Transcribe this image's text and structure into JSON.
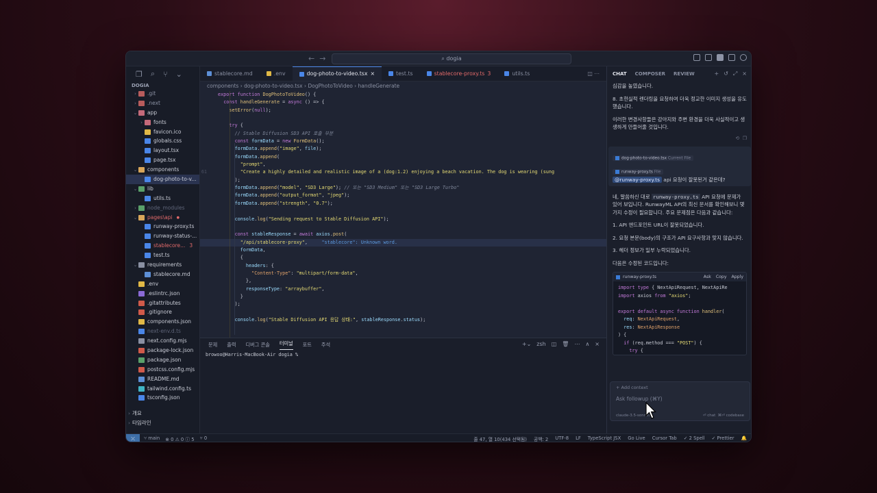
{
  "titlebar": {
    "search": "dogia"
  },
  "sidebar": {
    "title": "DOGIA",
    "items": [
      {
        "label": ".git",
        "indent": 1,
        "chev": "›",
        "color": "#8a90a2",
        "icon": "#b85c5c",
        "dim": true
      },
      {
        "label": ".next",
        "indent": 1,
        "chev": "›",
        "color": "#8a90a2",
        "icon": "#b85c5c",
        "dim": true
      },
      {
        "label": "app",
        "indent": 1,
        "chev": "⌄",
        "color": "#c9ccd6",
        "icon": "#c46a7a"
      },
      {
        "label": "fonts",
        "indent": 2,
        "chev": "›",
        "color": "#c9ccd6",
        "icon": "#c46a7a"
      },
      {
        "label": "favicon.ico",
        "indent": 2,
        "chev": "",
        "color": "#c9ccd6",
        "icon": "#e0b846"
      },
      {
        "label": "globals.css",
        "indent": 2,
        "chev": "",
        "color": "#c9ccd6",
        "icon": "#4a86e8"
      },
      {
        "label": "layout.tsx",
        "indent": 2,
        "chev": "",
        "color": "#c9ccd6",
        "icon": "#4a86e8"
      },
      {
        "label": "page.tsx",
        "indent": 2,
        "chev": "",
        "color": "#c9ccd6",
        "icon": "#4a86e8"
      },
      {
        "label": "components",
        "indent": 1,
        "chev": "⌄",
        "color": "#c9ccd6",
        "icon": "#d8a65a"
      },
      {
        "label": "dog-photo-to-v...",
        "indent": 2,
        "chev": "",
        "color": "#c9ccd6",
        "icon": "#4a86e8",
        "active": true
      },
      {
        "label": "lib",
        "indent": 1,
        "chev": "⌄",
        "color": "#c9ccd6",
        "icon": "#5aa06a"
      },
      {
        "label": "utils.ts",
        "indent": 2,
        "chev": "",
        "color": "#c9ccd6",
        "icon": "#4a86e8"
      },
      {
        "label": "node_modules",
        "indent": 1,
        "chev": "›",
        "color": "#5e6478",
        "icon": "#5aa06a",
        "dim": true
      },
      {
        "label": "pages\\api",
        "indent": 1,
        "chev": "⌄",
        "color": "#e26a6a",
        "icon": "#d8a65a",
        "dot": true
      },
      {
        "label": "runway-proxy.ts",
        "indent": 2,
        "chev": "",
        "color": "#c9ccd6",
        "icon": "#4a86e8"
      },
      {
        "label": "runway-status-...",
        "indent": 2,
        "chev": "",
        "color": "#c9ccd6",
        "icon": "#4a86e8"
      },
      {
        "label": "stablecore...",
        "indent": 2,
        "chev": "",
        "color": "#e26a6a",
        "icon": "#4a86e8",
        "badge": "3"
      },
      {
        "label": "test.ts",
        "indent": 2,
        "chev": "",
        "color": "#c9ccd6",
        "icon": "#4a86e8"
      },
      {
        "label": "requirements",
        "indent": 1,
        "chev": "⌄",
        "color": "#c9ccd6",
        "icon": "#8a90a2"
      },
      {
        "label": "stablecore.md",
        "indent": 2,
        "chev": "",
        "color": "#c9ccd6",
        "icon": "#5d8fd6"
      },
      {
        "label": ".env",
        "indent": 1,
        "chev": "",
        "color": "#c9ccd6",
        "icon": "#e0b846"
      },
      {
        "label": ".eslintrc.json",
        "indent": 1,
        "chev": "",
        "color": "#c9ccd6",
        "icon": "#8a6ad6"
      },
      {
        "label": ".gitattributes",
        "indent": 1,
        "chev": "",
        "color": "#c9ccd6",
        "icon": "#d05a4a"
      },
      {
        "label": ".gitignore",
        "indent": 1,
        "chev": "",
        "color": "#c9ccd6",
        "icon": "#d05a4a"
      },
      {
        "label": "components.json",
        "indent": 1,
        "chev": "",
        "color": "#c9ccd6",
        "icon": "#e0b846"
      },
      {
        "label": "next-env.d.ts",
        "indent": 1,
        "chev": "",
        "color": "#5e6478",
        "icon": "#4a86e8",
        "dim": true
      },
      {
        "label": "next.config.mjs",
        "indent": 1,
        "chev": "",
        "color": "#c9ccd6",
        "icon": "#8a90a2"
      },
      {
        "label": "package-lock.json",
        "indent": 1,
        "chev": "",
        "color": "#c9ccd6",
        "icon": "#d05a4a"
      },
      {
        "label": "package.json",
        "indent": 1,
        "chev": "",
        "color": "#c9ccd6",
        "icon": "#5aa06a"
      },
      {
        "label": "postcss.config.mjs",
        "indent": 1,
        "chev": "",
        "color": "#c9ccd6",
        "icon": "#d05a4a"
      },
      {
        "label": "README.md",
        "indent": 1,
        "chev": "",
        "color": "#c9ccd6",
        "icon": "#5d8fd6"
      },
      {
        "label": "tailwind.config.ts",
        "indent": 1,
        "chev": "",
        "color": "#c9ccd6",
        "icon": "#40b4c4"
      },
      {
        "label": "tsconfig.json",
        "indent": 1,
        "chev": "",
        "color": "#c9ccd6",
        "icon": "#4a86e8"
      }
    ],
    "bottom": [
      "개요",
      "타임라인"
    ]
  },
  "tabs": [
    {
      "label": "stablecore.md",
      "icon": "#5d8fd6"
    },
    {
      "label": ".env",
      "icon": "#e0b846"
    },
    {
      "label": "dog-photo-to-video.tsx",
      "icon": "#4a86e8",
      "active": true,
      "close": "×"
    },
    {
      "label": "test.ts",
      "icon": "#4a86e8"
    },
    {
      "label": "stablecore-proxy.ts",
      "icon": "#4a86e8",
      "error": true,
      "badge": "3"
    },
    {
      "label": "utils.ts",
      "icon": "#4a86e8"
    }
  ],
  "breadcrumb": "components  ›  dog-photo-to-video.tsx  ›  DogPhotoToVideo  ›  handleGenerate",
  "code_lines": [
    {
      "n": "",
      "t": "<span class='kw'>export function</span> <span class='fn'>DogPhotoToVideo</span>() {"
    },
    {
      "n": "",
      "t": "  <span class='kw'>const</span> <span class='fn'>handleGenerate</span> = <span class='kw'>async</span> () => {"
    },
    {
      "n": "",
      "t": "    <span class='fn'>setError</span>(<span class='kw'>null</span>);"
    },
    {
      "n": "",
      "t": ""
    },
    {
      "n": "",
      "t": "    <span class='kw'>try</span> {"
    },
    {
      "n": "",
      "t": "      <span class='cm'>// Stable Diffusion SD3 API 호출 부분</span>"
    },
    {
      "n": "",
      "t": "      <span class='kw'>const</span> <span class='vr'>formData</span> = <span class='kw'>new</span> <span class='fn'>FormData</span>();"
    },
    {
      "n": "",
      "t": "      <span class='vr'>formData</span>.<span class='fn'>append</span>(<span class='str'>\"image\"</span>, <span class='vr'>file</span>);"
    },
    {
      "n": "",
      "t": "      <span class='vr'>formData</span>.<span class='fn'>append</span>("
    },
    {
      "n": "",
      "t": "        <span class='str'>\"prompt\"</span>,"
    },
    {
      "n": "61",
      "t": "        <span class='str'>\"Create a highly detailed and realistic image of a (dog:1.2) enjoying a beach vacation. The dog is wearing (sung</span>"
    },
    {
      "n": "",
      "t": "      );"
    },
    {
      "n": "",
      "t": "      <span class='vr'>formData</span>.<span class='fn'>append</span>(<span class='str'>\"model\"</span>, <span class='str'>\"SD3 Large\"</span>); <span class='cm'>// 또는 \"SD3 Medium\" 또는 \"SD3 Large Turbo\"</span>"
    },
    {
      "n": "",
      "t": "      <span class='vr'>formData</span>.<span class='fn'>append</span>(<span class='str'>\"output_format\"</span>, <span class='str'>\"jpeg\"</span>);"
    },
    {
      "n": "",
      "t": "      <span class='vr'>formData</span>.<span class='fn'>append</span>(<span class='str'>\"strength\"</span>, <span class='str'>\"0.7\"</span>);"
    },
    {
      "n": "",
      "t": ""
    },
    {
      "n": "",
      "t": "      <span class='vr'>console</span>.<span class='fn'>log</span>(<span class='str'>\"Sending request to Stable Diffusion API\"</span>);"
    },
    {
      "n": "",
      "t": ""
    },
    {
      "n": "",
      "t": "      <span class='kw'>const</span> <span class='vr'>stableResponse</span> = <span class='kw'>await</span> <span class='vr'>axios</span>.<span class='fn'>post</span>("
    },
    {
      "n": "",
      "t": "        <span class='str'>\"/api/stablecore-proxy\"</span>,     <span class='warn'>\"stablecore\": Unknown word.</span>",
      "hl": true
    },
    {
      "n": "",
      "t": "        <span class='vr'>formData</span>,"
    },
    {
      "n": "",
      "t": "        {"
    },
    {
      "n": "",
      "t": "          <span class='vr'>headers</span>: {"
    },
    {
      "n": "",
      "t": "            <span class='pr'>\"Content-Type\"</span>: <span class='str'>\"multipart/form-data\"</span>,"
    },
    {
      "n": "",
      "t": "          },"
    },
    {
      "n": "",
      "t": "          <span class='vr'>responseType</span>: <span class='str'>\"arraybuffer\"</span>,"
    },
    {
      "n": "",
      "t": "        }"
    },
    {
      "n": "",
      "t": "      );"
    },
    {
      "n": "",
      "t": ""
    },
    {
      "n": "",
      "t": "      <span class='vr'>console</span>.<span class='fn'>log</span>(<span class='str'>\"Stable Diffusion API 응답 상태:\"</span>, <span class='vr'>stableResponse</span>.<span class='vr'>status</span>);"
    }
  ],
  "panel": {
    "tabs": [
      "문제",
      "출력",
      "디버그 콘솔",
      "터미널",
      "포트",
      "주석"
    ],
    "active": "터미널",
    "shell": "zsh",
    "prompt": "browoo@Harris-MacBook-Air dogia %"
  },
  "chat": {
    "tabs": [
      "CHAT",
      "COMPOSER",
      "REVIEW"
    ],
    "intro": [
      "심감을 높였습니다.",
      "8. 초현실적 렌더링을 요청하여 더욱 정교한 이미지 생성을 유도했습니다.",
      "이러한 변경사항들은 강아지와 주변 환경을 더욱 사실적이고 생생하게 만들어줄 것입니다."
    ],
    "chip1": "dog-photo-to-video.tsx",
    "chip1_note": "Current File",
    "chip2": "runway-proxy.ts",
    "chip2_note": "File",
    "user_mention": "@runway-proxy.ts",
    "user_msg": " api 요청이 잘못된거 같은데?",
    "reply_a": "네, 말씀하신 대로 ",
    "reply_code": "runway-proxy.ts",
    "reply_b": " API 요청에 문제가 있어 보입니다. RunwayML API의 최신 문서를 확인해보니 몇 가지 수정이 필요합니다. 주요 문제점은 다음과 같습니다:",
    "points": [
      "1. API 엔드포인트 URL이 잘못되었습니다.",
      "2. 요청 본문(body)의 구조가 API 요구사항과 맞지 않습니다.",
      "3. 헤더 정보가 일부 누락되었습니다."
    ],
    "after": "다음은 수정된 코드입니다:",
    "codeblock": {
      "file": "runway-proxy.ts",
      "actions": [
        "Ask",
        "Copy",
        "Apply"
      ],
      "lines": [
        "<span class='kw'>import type</span> { NextApiRequest, NextApiRe",
        "<span class='kw'>import</span> axios <span class='kw'>from</span> <span class='str'>\"axios\"</span>;",
        "",
        "<span class='kw'>export default async function</span> <span class='fn'>handler</span>(",
        "  <span class='vr'>req</span>: <span class='pr'>NextApiRequest</span>,",
        "  <span class='vr'>res</span>: <span class='pr'>NextApiResponse</span>",
        ") {",
        "  <span class='kw'>if</span> (req.method === <span class='str'>\"POST\"</span>) {",
        "    <span class='kw'>try</span> {"
      ]
    },
    "composer": {
      "add_context": "+  Add context",
      "placeholder": "Ask followup (⌘Y)",
      "model": "claude-3.5-sonnet",
      "chat": "⏎ chat",
      "codebase": "⌘⏎ codebase"
    }
  },
  "status": {
    "branch": "main",
    "problems": "⊗ 0 ⚠ 0  ⓘ 5",
    "ports": "⑂ 0",
    "position": "줄 47, 열 10(434 선택됨)",
    "spaces": "공백: 2",
    "encoding": "UTF-8",
    "eol": "LF",
    "lang": "TypeScript JSX",
    "golive": "Go Live",
    "cursortab": "Cursor Tab",
    "spell": "✓ 2 Spell",
    "prettier": "✓ Prettier"
  }
}
